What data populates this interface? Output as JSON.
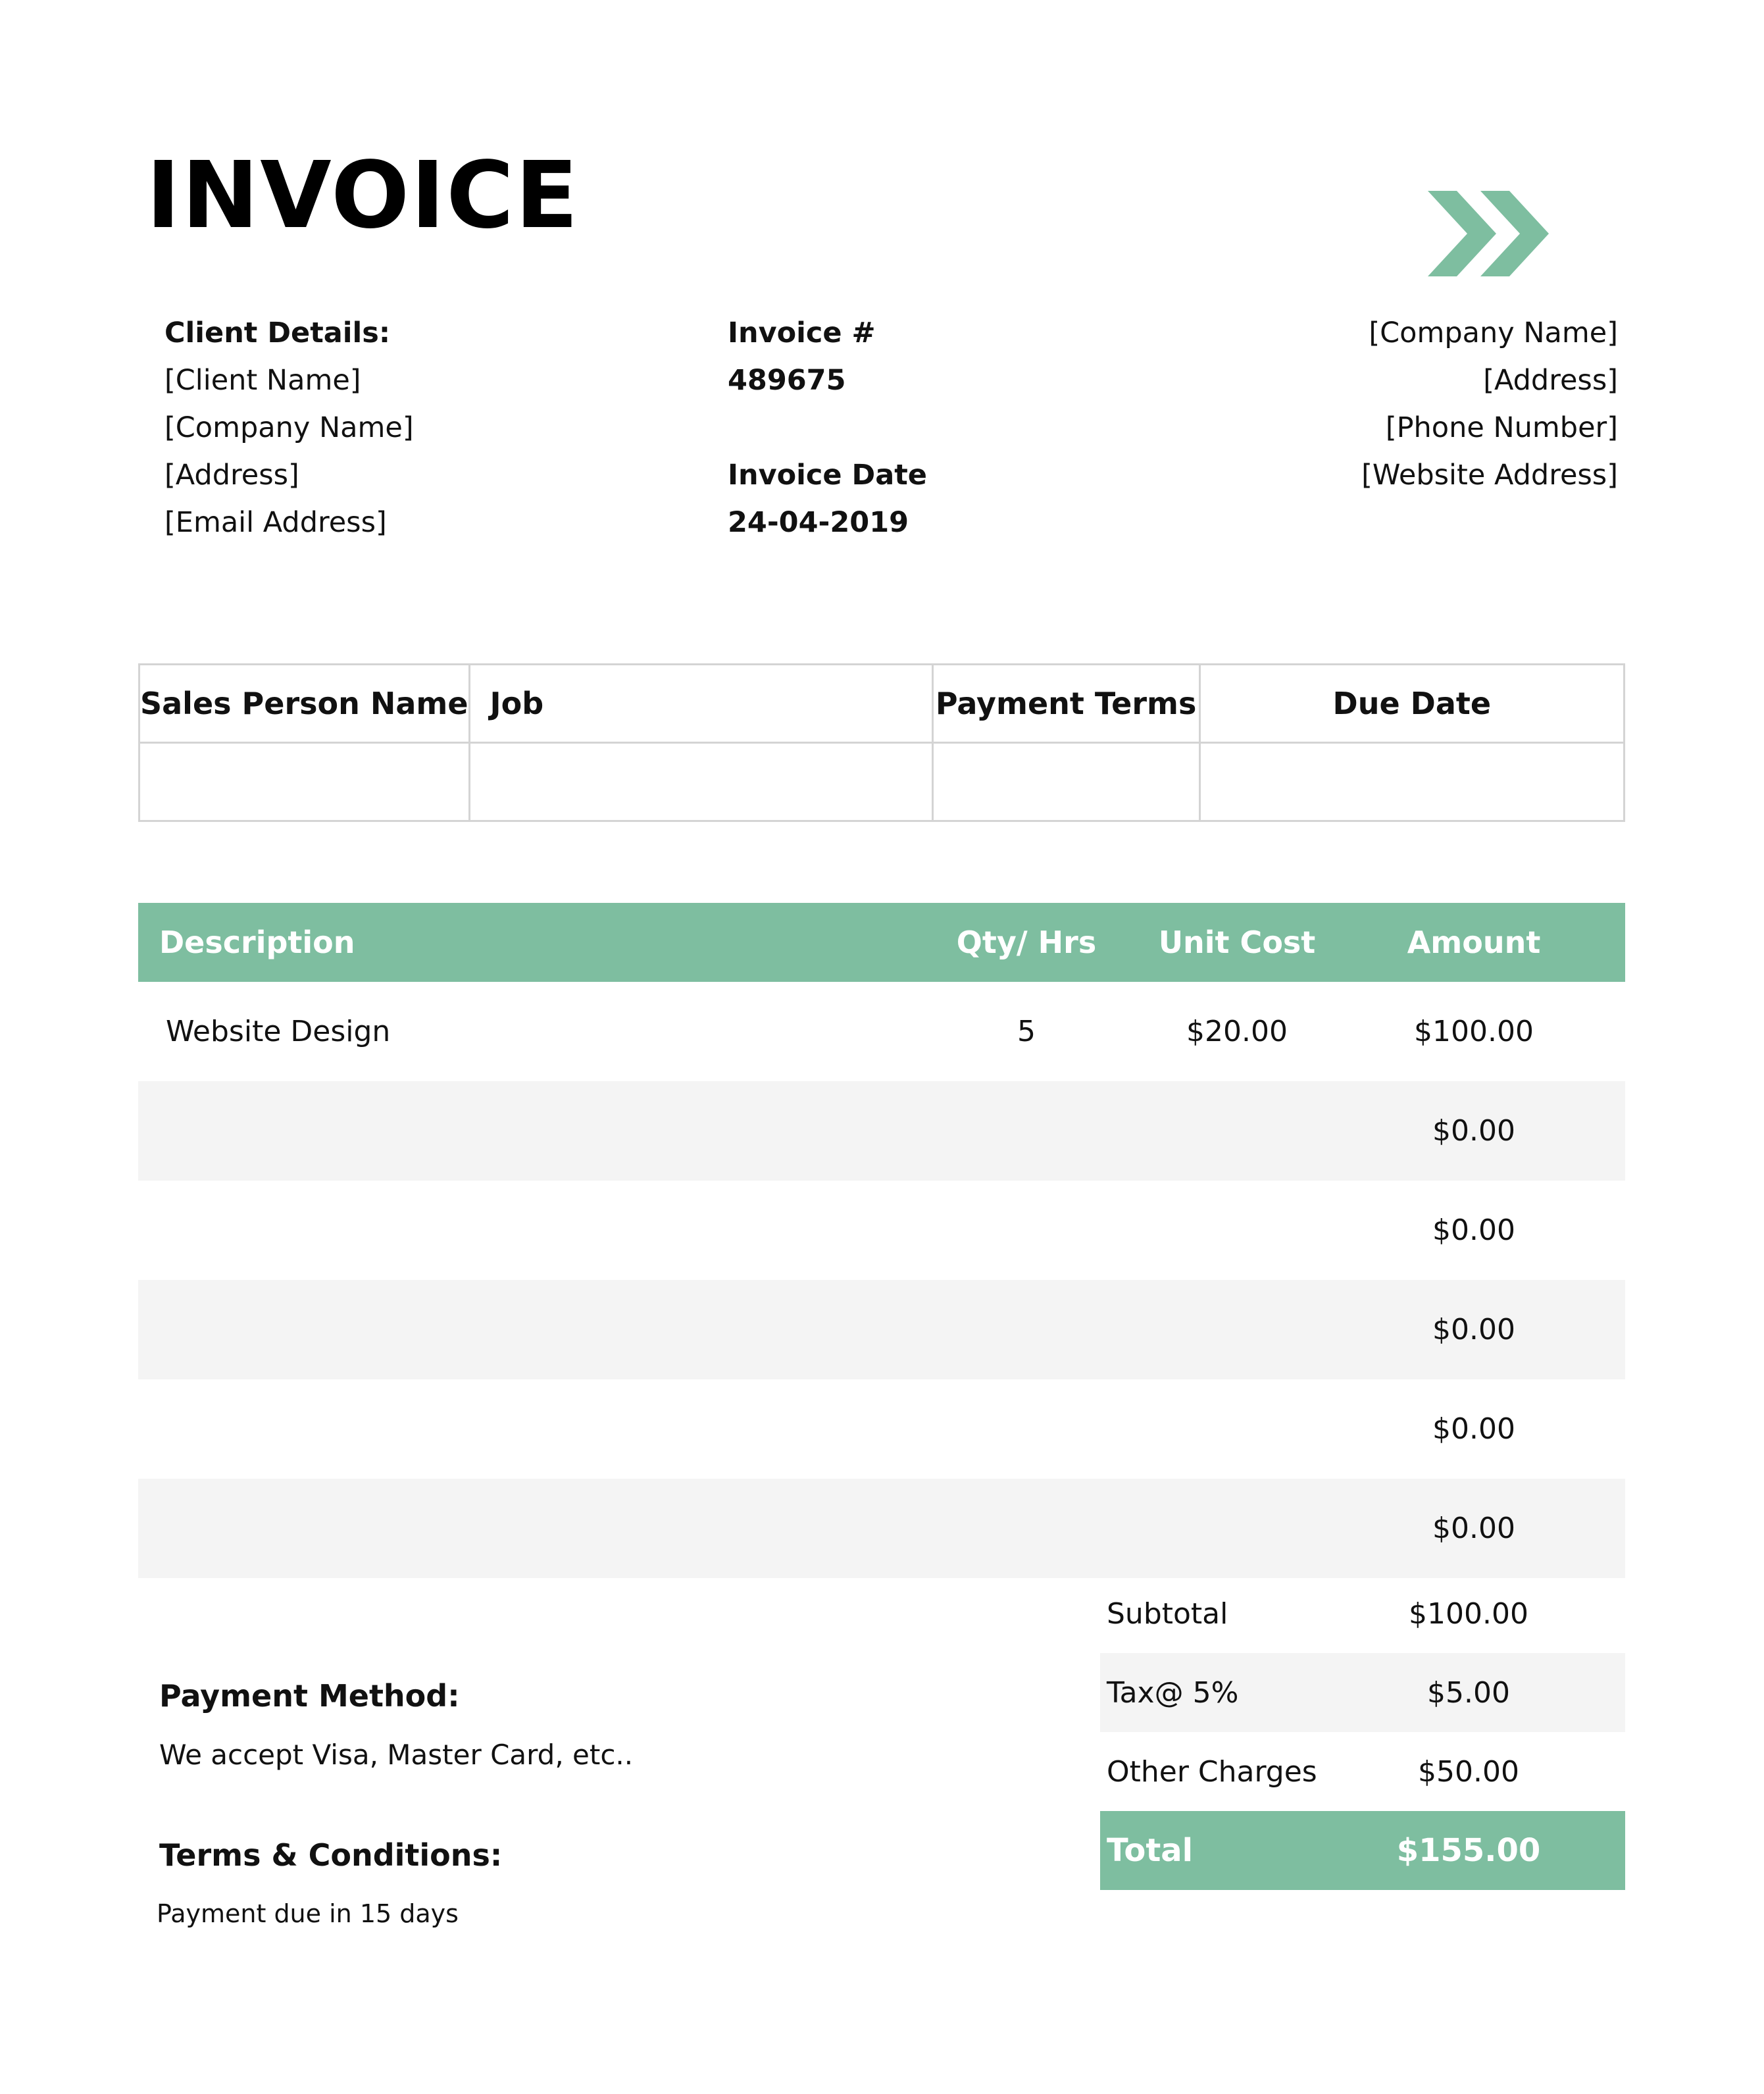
{
  "title": "INVOICE",
  "colors": {
    "accent": "#7ebea0",
    "alt_row": "#f4f4f4"
  },
  "logo": {
    "icon": "double-chevron-right-icon"
  },
  "client": {
    "heading": "Client Details:",
    "lines": [
      "[Client Name]",
      "[Company Name]",
      "[Address]",
      "[Email Address]"
    ]
  },
  "invoice": {
    "number_label": "Invoice #",
    "number": "489675",
    "date_label": "Invoice Date",
    "date": "24-04-2019"
  },
  "company": {
    "lines": [
      "[Company Name]",
      "[Address]",
      "[Phone Number]",
      "[Website Address]"
    ]
  },
  "meta_table": {
    "headers": [
      "Sales Person Name",
      "Job",
      "Payment Terms",
      "Due Date"
    ],
    "values": [
      "",
      "",
      "",
      ""
    ]
  },
  "items": {
    "headers": {
      "description": "Description",
      "qty": "Qty/ Hrs",
      "unit_cost": "Unit Cost",
      "amount": "Amount"
    },
    "rows": [
      {
        "description": "Website Design",
        "qty": "5",
        "unit_cost": "$20.00",
        "amount": "$100.00"
      },
      {
        "description": "",
        "qty": "",
        "unit_cost": "",
        "amount": "$0.00"
      },
      {
        "description": "",
        "qty": "",
        "unit_cost": "",
        "amount": "$0.00"
      },
      {
        "description": "",
        "qty": "",
        "unit_cost": "",
        "amount": "$0.00"
      },
      {
        "description": "",
        "qty": "",
        "unit_cost": "",
        "amount": "$0.00"
      },
      {
        "description": "",
        "qty": "",
        "unit_cost": "",
        "amount": "$0.00"
      }
    ]
  },
  "totals": {
    "subtotal_label": "Subtotal",
    "subtotal": "$100.00",
    "tax_label": "Tax@ 5%",
    "tax": "$5.00",
    "other_label": "Other Charges",
    "other": "$50.00",
    "total_label": "Total",
    "total": "$155.00"
  },
  "payment_method": {
    "heading": "Payment Method:",
    "text": "We accept Visa, Master Card, etc.."
  },
  "terms": {
    "heading": "Terms & Conditions:",
    "text": "Payment due in 15 days"
  }
}
